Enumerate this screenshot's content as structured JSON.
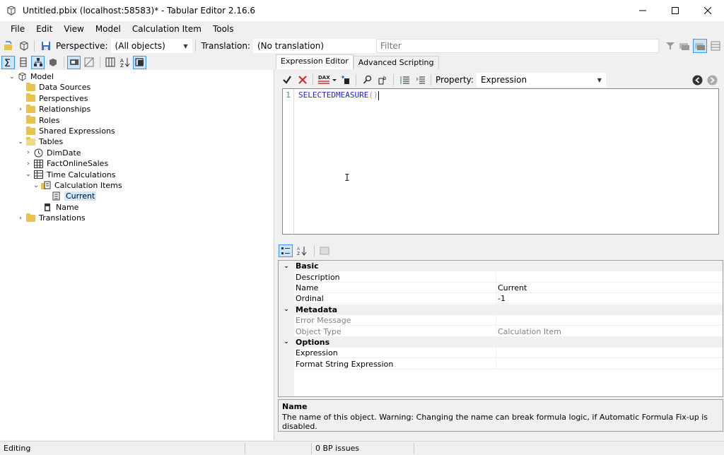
{
  "window": {
    "title": "Untitled.pbix (localhost:58583)* - Tabular Editor 2.16.6",
    "controls": [
      "minimize",
      "maximize",
      "close"
    ]
  },
  "menu": [
    "File",
    "Edit",
    "View",
    "Model",
    "Calculation Item",
    "Tools"
  ],
  "toolbar": {
    "perspective_label": "Perspective:",
    "perspective_value": "(All objects)",
    "translation_label": "Translation:",
    "translation_value": "(No translation)",
    "filter_placeholder": "Filter"
  },
  "tree": {
    "root": "Model",
    "items": [
      {
        "label": "Data Sources",
        "depth": 1,
        "expander": "",
        "icon": "folder-icon"
      },
      {
        "label": "Perspectives",
        "depth": 1,
        "expander": "",
        "icon": "folder-icon"
      },
      {
        "label": "Relationships",
        "depth": 1,
        "expander": ">",
        "icon": "folder-icon"
      },
      {
        "label": "Roles",
        "depth": 1,
        "expander": "",
        "icon": "folder-icon"
      },
      {
        "label": "Shared Expressions",
        "depth": 1,
        "expander": "",
        "icon": "folder-icon"
      },
      {
        "label": "Tables",
        "depth": 1,
        "expander": "v",
        "icon": "folder-open-icon"
      },
      {
        "label": "DimDate",
        "depth": 2,
        "expander": ">",
        "icon": "date-table-icon"
      },
      {
        "label": "FactOnlineSales",
        "depth": 2,
        "expander": ">",
        "icon": "table-icon"
      },
      {
        "label": "Time Calculations",
        "depth": 2,
        "expander": "v",
        "icon": "calc-group-icon"
      },
      {
        "label": "Calculation Items",
        "depth": 3,
        "expander": "v",
        "icon": "calc-items-icon"
      },
      {
        "label": "Current",
        "depth": 4,
        "expander": "",
        "icon": "calc-item-icon",
        "selected": true
      },
      {
        "label": "Name",
        "depth": 3,
        "expander": "",
        "icon": "column-icon"
      },
      {
        "label": "Translations",
        "depth": 1,
        "expander": ">",
        "icon": "folder-icon"
      }
    ]
  },
  "tabs": [
    "Expression Editor",
    "Advanced Scripting"
  ],
  "expression_toolbar": {
    "property_label": "Property:",
    "property_value": "Expression",
    "dax_label": "DAX"
  },
  "editor": {
    "line_number": "1",
    "code_keyword": "SELECTEDMEASURE",
    "code_parens": "()"
  },
  "properties": {
    "categories": [
      {
        "name": "Basic",
        "rows": [
          {
            "name": "Description",
            "value": ""
          },
          {
            "name": "Name",
            "value": "Current"
          },
          {
            "name": "Ordinal",
            "value": "-1"
          }
        ]
      },
      {
        "name": "Metadata",
        "rows": [
          {
            "name": "Error Message",
            "value": "",
            "disabled": true
          },
          {
            "name": "Object Type",
            "value": "Calculation Item",
            "disabled": true
          }
        ]
      },
      {
        "name": "Options",
        "rows": [
          {
            "name": "Expression",
            "value": ""
          },
          {
            "name": "Format String Expression",
            "value": ""
          }
        ]
      }
    ]
  },
  "description": {
    "title": "Name",
    "text": "The name of this object. Warning: Changing the name can break formula logic, if Automatic Formula Fix-up is disabled."
  },
  "status": {
    "mode": "Editing",
    "bp_issues": "0 BP issues"
  }
}
